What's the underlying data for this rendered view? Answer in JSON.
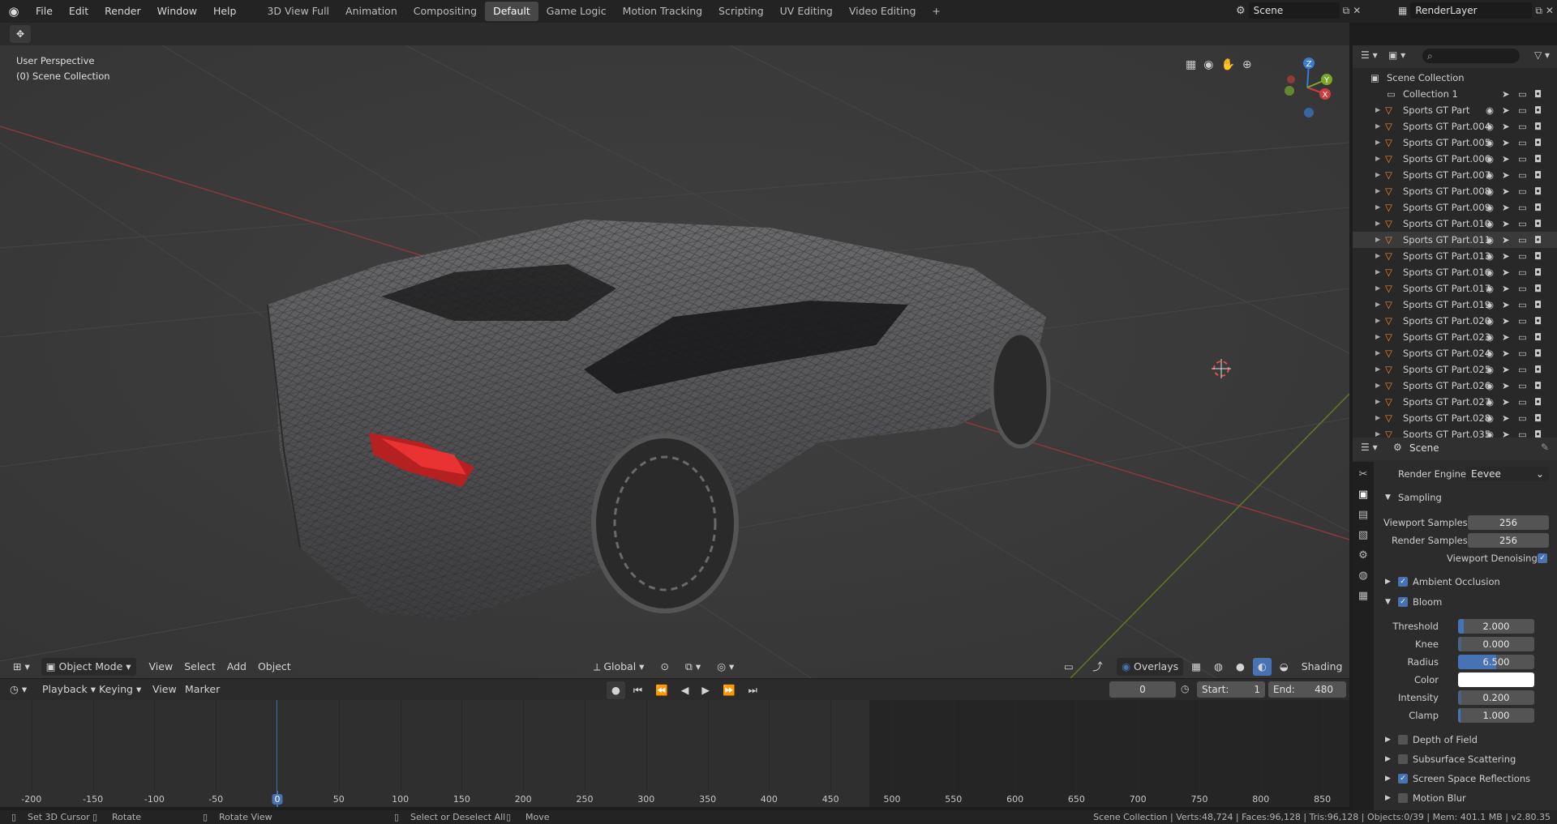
{
  "topbar": {
    "menus": [
      "File",
      "Edit",
      "Render",
      "Window",
      "Help"
    ],
    "workspaces": [
      "3D View Full",
      "Animation",
      "Compositing",
      "Default",
      "Game Logic",
      "Motion Tracking",
      "Scripting",
      "UV Editing",
      "Video Editing"
    ],
    "active_workspace": "Default",
    "add_tab": "+",
    "scene_label": "Scene",
    "render_layer_label": "RenderLayer"
  },
  "viewport": {
    "view_name": "User Perspective",
    "collection": "(0) Scene Collection",
    "mode": "Object Mode",
    "menus": [
      "View",
      "Select",
      "Add",
      "Object"
    ],
    "transform": "Global",
    "overlays": "Overlays",
    "shading": "Shading",
    "gizmo": {
      "x": "X",
      "y": "Y",
      "z": "Z"
    }
  },
  "outliner": {
    "root": "Scene Collection",
    "collection": "Collection 1",
    "items": [
      "Sports GT Part",
      "Sports GT Part.004",
      "Sports GT Part.005",
      "Sports GT Part.006",
      "Sports GT Part.007",
      "Sports GT Part.008",
      "Sports GT Part.009",
      "Sports GT Part.010",
      "Sports GT Part.011",
      "Sports GT Part.013",
      "Sports GT Part.016",
      "Sports GT Part.017",
      "Sports GT Part.019",
      "Sports GT Part.020",
      "Sports GT Part.023",
      "Sports GT Part.024",
      "Sports GT Part.025",
      "Sports GT Part.026",
      "Sports GT Part.027",
      "Sports GT Part.028",
      "Sports GT Part.035"
    ],
    "selected_item": "Sports GT Part.011"
  },
  "properties": {
    "context": "Scene",
    "render_engine_label": "Render Engine",
    "render_engine": "Eevee",
    "sampling": {
      "title": "Sampling",
      "viewport_samples_label": "Viewport Samples",
      "viewport_samples": "256",
      "render_samples_label": "Render Samples",
      "render_samples": "256",
      "viewport_denoising": "Viewport Denoising"
    },
    "ambient_occlusion": "Ambient Occlusion",
    "bloom": {
      "title": "Bloom",
      "threshold_label": "Threshold",
      "threshold": "2.000",
      "threshold_fill": 0.07,
      "knee_label": "Knee",
      "knee": "0.000",
      "knee_fill": 0.0,
      "radius_label": "Radius",
      "radius": "6.500",
      "radius_fill": 0.5,
      "color_label": "Color",
      "color": "#ffffff",
      "intensity_label": "Intensity",
      "intensity": "0.200",
      "intensity_fill": 0.0,
      "clamp_label": "Clamp",
      "clamp": "1.000",
      "clamp_fill": 0.03
    },
    "depth_of_field": "Depth of Field",
    "subsurface_scattering": "Subsurface Scattering",
    "screen_space_reflections": "Screen Space Reflections",
    "motion_blur": "Motion Blur"
  },
  "timeline": {
    "menus": [
      "Playback",
      "Keying",
      "View",
      "Marker"
    ],
    "current_frame": "0",
    "start_label": "Start:",
    "start": "1",
    "end_label": "End:",
    "end": "480",
    "ticks": [
      "-200",
      "-150",
      "-100",
      "-50",
      "0",
      "50",
      "100",
      "150",
      "200",
      "250",
      "300",
      "350",
      "400",
      "450",
      "500",
      "550",
      "600",
      "650",
      "700",
      "750",
      "800",
      "850"
    ]
  },
  "statusbar": {
    "hints": [
      "Set 3D Cursor",
      "Rotate",
      "Rotate View",
      "Select or Deselect All",
      "Move"
    ],
    "stats": "Scene Collection | Verts:48,724 | Faces:96,128 | Tris:96,128 | Objects:0/39 | Mem: 401.1 MB | v2.80.35"
  },
  "colors": {
    "accent": "#4772b3",
    "object_orange": "#e8883a",
    "x_axis": "#d03c3c",
    "y_axis": "#7ba82a",
    "z_axis": "#3b7bd0"
  }
}
